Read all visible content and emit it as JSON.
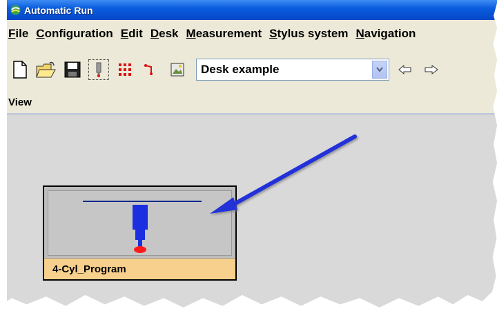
{
  "window": {
    "title": "Automatic Run"
  },
  "menu": {
    "items": [
      {
        "mnemonic": "F",
        "rest": "ile"
      },
      {
        "mnemonic": "C",
        "rest": "onfiguration"
      },
      {
        "mnemonic": "E",
        "rest": "dit"
      },
      {
        "mnemonic": "D",
        "rest": "esk"
      },
      {
        "mnemonic": "M",
        "rest": "easurement"
      },
      {
        "mnemonic": "S",
        "rest": "tylus system"
      },
      {
        "mnemonic": "N",
        "rest": "avigation"
      }
    ]
  },
  "toolbar": {
    "icons": [
      "new-document-icon",
      "open-folder-icon",
      "save-icon",
      "stylus-icon",
      "grid-points-icon",
      "path-icon",
      "picture-icon",
      "back-arrow-icon",
      "forward-arrow-icon"
    ],
    "desk_combo_value": "Desk example"
  },
  "view": {
    "label": "View"
  },
  "program_tile": {
    "caption": "4-Cyl_Program"
  },
  "colors": {
    "titlebar": "#0b5ddf",
    "menubar": "#ece9d8",
    "tile_caption": "#f6d08c",
    "annotation_arrow": "#2030d8",
    "stylus_body": "#1b2fe0",
    "stylus_tip": "#ff1a1a"
  }
}
